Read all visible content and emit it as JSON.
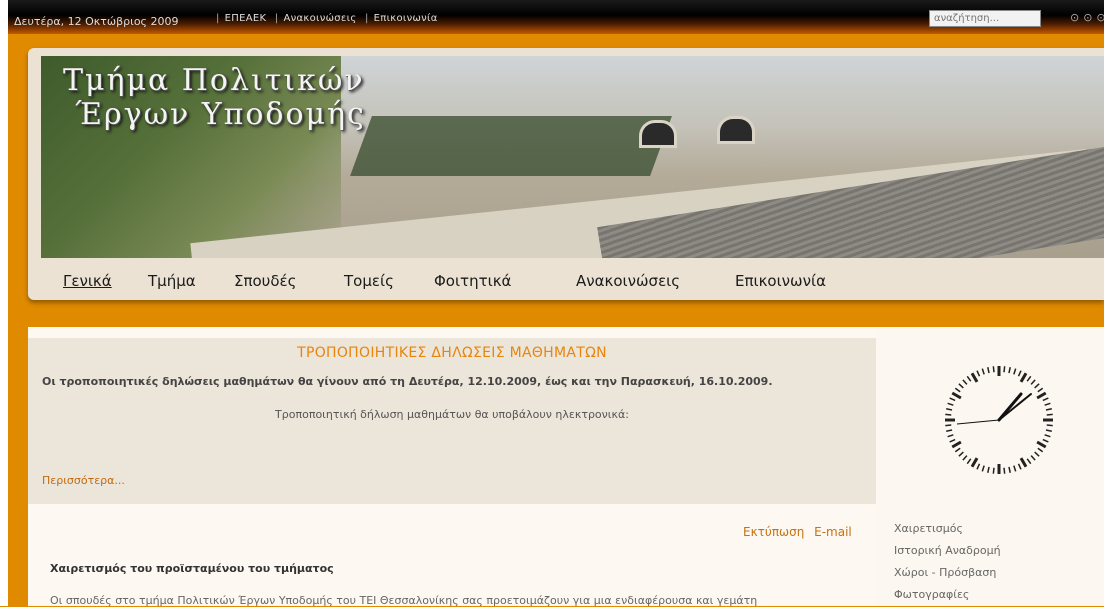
{
  "topbar": {
    "date": "Δευτέρα, 12 Οκτώβριος 2009",
    "links": [
      "ΕΠΕΑΕΚ",
      "Ανακοινώσεις",
      "Επικοινωνία"
    ],
    "search_placeholder": "αναζήτηση..."
  },
  "banner": {
    "title_line1": "Τμήμα Πολιτικών",
    "title_line2": "Έργων Υποδομής"
  },
  "nav": {
    "items": [
      "Γενικά",
      "Τμήμα",
      "Σπουδές",
      "Τομείς",
      "Φοιτητικά",
      "Ανακοινώσεις",
      "Επικοινωνία"
    ]
  },
  "notice": {
    "title": "ΤΡΟΠΟΠΟΙΗΤΙΚΕΣ ΔΗΛΩΣΕΙΣ ΜΑΘΗΜΑΤΩΝ",
    "bold_text": "Οι τροποποιητικές δηλώσεις μαθημάτων θα γίνουν από τη Δευτέρα, 12.10.2009, έως και την Παρασκευή, 16.10.2009.",
    "text": "Τροποποιητική δήλωση μαθημάτων θα υποβάλουν ηλεκτρονικά:",
    "more": "Περισσότερα..."
  },
  "article": {
    "print": "Εκτύπωση",
    "email": "E-mail",
    "title": "Χαιρετισμός του προϊσταμένου του τμήματος",
    "text": "Οι σπουδές στο τμήμα Πολιτικών Έργων Υποδομής του ΤΕΙ Θεσσαλονίκης σας προετοιμάζουν για μια ενδιαφέρουσα και γεμάτη"
  },
  "sidebar": {
    "links": [
      "Χαιρετισμός",
      "Ιστορική Αναδρομή",
      "Χώροι - Πρόσβαση",
      "Φωτογραφίες"
    ]
  },
  "colors": {
    "background": "#e08a00",
    "accent": "#e8850c",
    "link": "#c06a10"
  }
}
